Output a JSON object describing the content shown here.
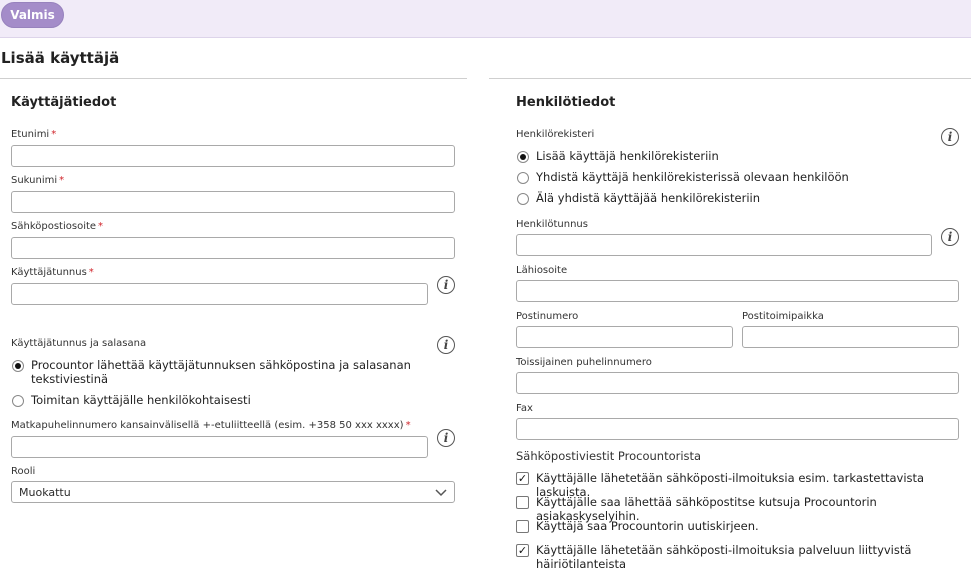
{
  "toolbar": {
    "done_label": "Valmis"
  },
  "page": {
    "title": "Lisää käyttäjä"
  },
  "user_info": {
    "title": "Käyttäjätiedot",
    "first_name_label": "Etunimi",
    "last_name_label": "Sukunimi",
    "email_label": "Sähköpostiosoite",
    "username_label": "Käyttäjätunnus",
    "credentials_label": "Käyttäjätunnus ja salasana",
    "credentials_options": [
      {
        "label": "Procountor lähettää käyttäjätunnuksen sähköpostina ja salasanan tekstiviestinä",
        "selected": true
      },
      {
        "label": "Toimitan käyttäjälle henkilökohtaisesti",
        "selected": false
      }
    ],
    "mobile_label": "Matkapuhelinnumero kansainvälisellä +-etuliitteellä (esim. +358 50 xxx xxxx)",
    "role_label": "Rooli",
    "role_value": "Muokattu",
    "required_mark": "*"
  },
  "person_info": {
    "title": "Henkilötiedot",
    "registry_label": "Henkilörekisteri",
    "registry_options": [
      {
        "label": "Lisää käyttäjä henkilörekisteriin",
        "selected": true
      },
      {
        "label": "Yhdistä käyttäjä henkilörekisterissä olevaan henkilöön",
        "selected": false
      },
      {
        "label": "Älä yhdistä käyttäjää henkilörekisteriin",
        "selected": false
      }
    ],
    "ssn_label": "Henkilötunnus",
    "address_label": "Lähiosoite",
    "postal_code_label": "Postinumero",
    "city_label": "Postitoimipaikka",
    "secondary_phone_label": "Toissijainen puhelinnumero",
    "fax_label": "Fax",
    "emails_label": "Sähköpostiviestit Procountorista",
    "email_options": [
      {
        "label": "Käyttäjälle lähetetään sähköposti-ilmoituksia esim. tarkastettavista laskuista.",
        "checked": true
      },
      {
        "label": "Käyttäjälle saa lähettää sähköpostitse kutsuja Procountorin asiakaskyselyihin.",
        "checked": false
      },
      {
        "label": "Käyttäjä saa Procountorin uutiskirjeen.",
        "checked": false
      },
      {
        "label": "Käyttäjälle lähetetään sähköposti-ilmoituksia palveluun liittyvistä häiriötilanteista",
        "checked": true
      }
    ]
  },
  "icons": {
    "info": "info-icon",
    "chevron": "chevron-down-icon",
    "checkmark": "✓"
  },
  "colors": {
    "accent": "#a48cc9",
    "topbar": "#f1ebf8",
    "required": "#d0242a"
  }
}
